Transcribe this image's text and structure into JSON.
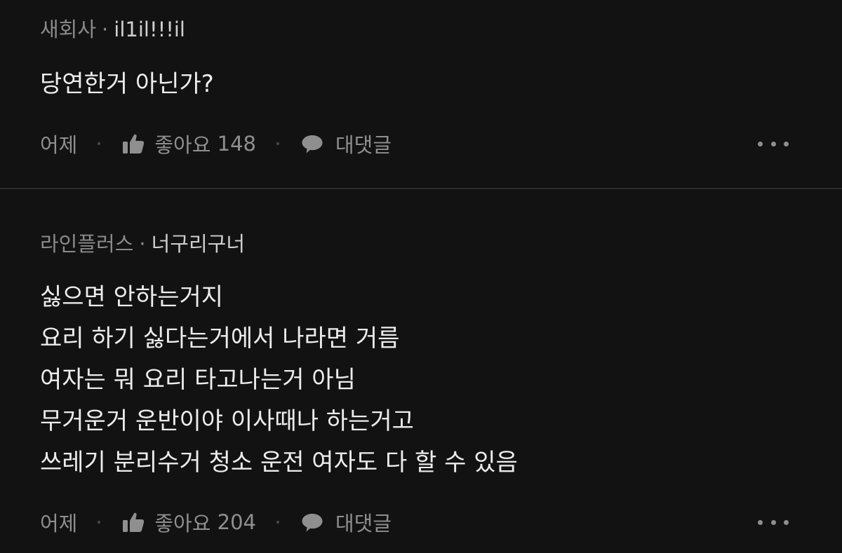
{
  "comments": [
    {
      "company": "새회사",
      "separator": "·",
      "nickname": "il1il!!!il",
      "lines": [
        "당연한거 아닌가?"
      ],
      "time": "어제",
      "like_label": "좋아요",
      "like_count": "148",
      "reply_label": "대댓글"
    },
    {
      "company": "라인플러스",
      "separator": "·",
      "nickname": "너구리구너",
      "lines": [
        "싫으면 안하는거지",
        "요리 하기 싫다는거에서 나라면 거름",
        "여자는 뭐 요리 타고나는거 아님",
        "무거운거 운반이야 이사때나 하는거고",
        "쓰레기 분리수거 청소 운전 여자도 다 할 수 있음"
      ],
      "time": "어제",
      "like_label": "좋아요",
      "like_count": "204",
      "reply_label": "대댓글"
    }
  ],
  "icons": {
    "like": "thumbs-up-icon",
    "reply": "speech-bubble-icon",
    "more": "more-horizontal-icon"
  },
  "colors": {
    "background": "#121212",
    "divider": "#2c2c2c",
    "muted_text": "#8f8f8f",
    "body_text": "#ececec"
  }
}
